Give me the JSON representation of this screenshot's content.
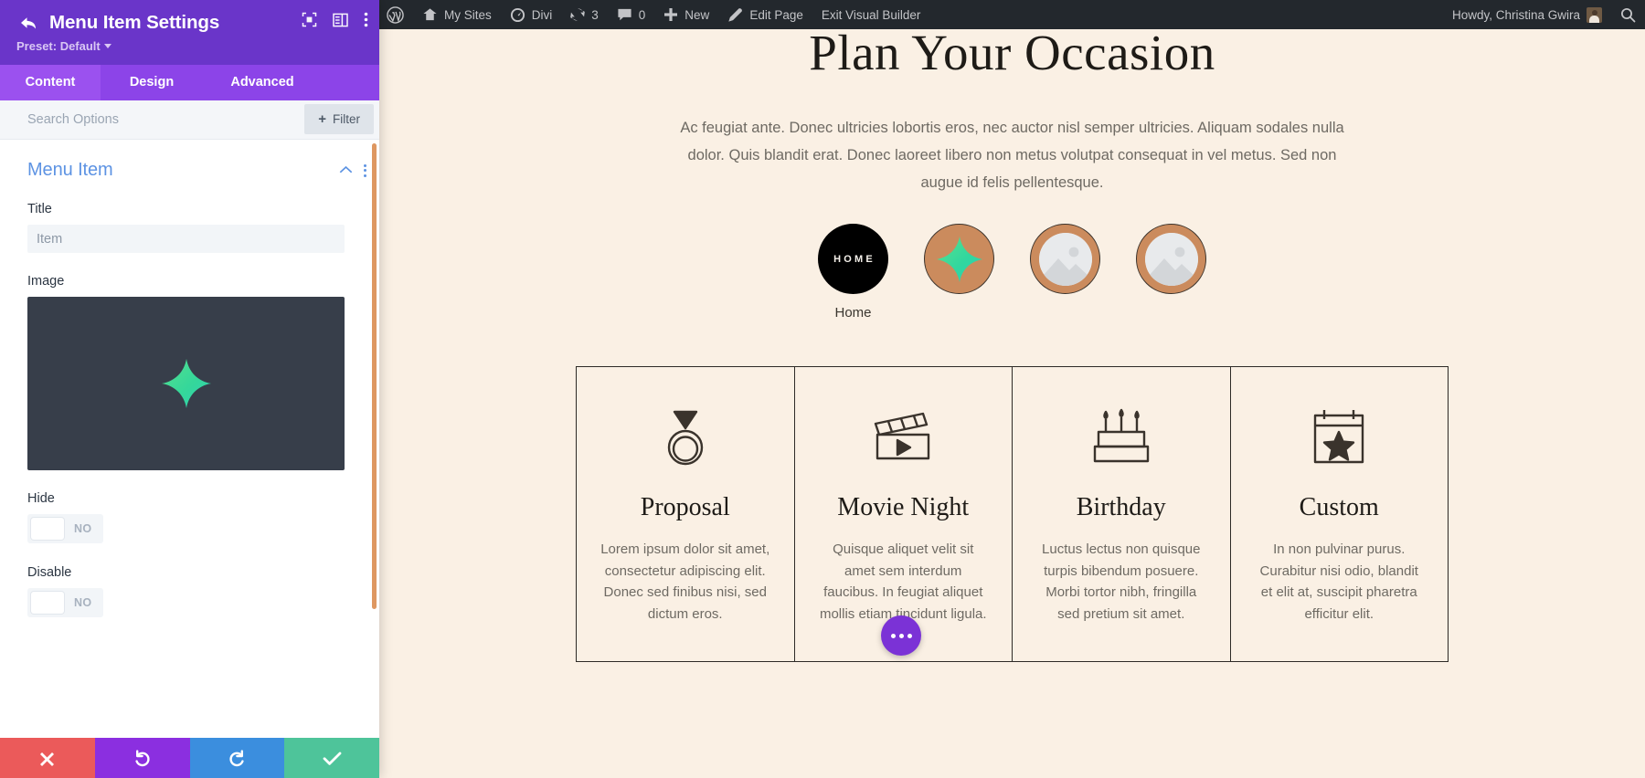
{
  "panel": {
    "title": "Menu Item Settings",
    "preset_label": "Preset: Default",
    "back_icon": "back-arrow-icon",
    "header_icon_1": "focus-target-icon",
    "header_icon_2": "layout-columns-icon",
    "header_icon_3": "more-vertical-icon",
    "tabs": [
      {
        "label": "Content",
        "active": true
      },
      {
        "label": "Design",
        "active": false
      },
      {
        "label": "Advanced",
        "active": false
      }
    ],
    "search_placeholder": "Search Options",
    "search_value": "",
    "filter_label": "Filter",
    "section": {
      "title": "Menu Item",
      "collapse_icon": "chevron-up-icon",
      "menu_icon": "more-vertical-icon"
    },
    "fields": {
      "title_label": "Title",
      "title_placeholder": "Item",
      "title_value": "",
      "image_label": "Image",
      "hide_label": "Hide",
      "hide_value": "NO",
      "disable_label": "Disable",
      "disable_value": "NO"
    },
    "footer": [
      {
        "name": "cancel-button",
        "icon": "close-icon",
        "color": "#eb5a5a"
      },
      {
        "name": "undo-button",
        "icon": "undo-icon",
        "color": "#8b2fe0"
      },
      {
        "name": "redo-button",
        "icon": "redo-icon",
        "color": "#3b8ede"
      },
      {
        "name": "save-button",
        "icon": "check-icon",
        "color": "#4ec49a"
      }
    ],
    "colors": {
      "header_purple": "#6a35c9",
      "tab_purple": "#8c44e8",
      "active_tab_purple": "#9b51ef",
      "section_blue": "#5d93e3"
    }
  },
  "adminbar": {
    "items": [
      {
        "label": "",
        "icon": "wordpress-logo-icon"
      },
      {
        "label": "My Sites",
        "icon": "sites-icon"
      },
      {
        "label": "Divi",
        "icon": "dashboard-icon"
      },
      {
        "label": "3",
        "icon": "updates-icon"
      },
      {
        "label": "0",
        "icon": "comments-icon"
      },
      {
        "label": "New",
        "icon": "plus-icon"
      },
      {
        "label": "Edit Page",
        "icon": "pencil-icon"
      },
      {
        "label": "Exit Visual Builder",
        "icon": ""
      }
    ],
    "howdy": "Howdy, Christina Gwira",
    "avatar": "user-avatar",
    "search_icon": "search-icon"
  },
  "page": {
    "heading": "Plan Your Occasion",
    "subtext": "Ac feugiat ante. Donec ultricies lobortis eros, nec auctor nisl semper ultricies. Aliquam sodales nulla dolor. Quis blandit erat. Donec laoreet libero non metus volutpat consequat in vel metus. Sed non augue id felis pellentesque.",
    "menu_circles": [
      {
        "type": "home",
        "text": "HOME",
        "label": "Home"
      },
      {
        "type": "sparkle",
        "text": "",
        "label": ""
      },
      {
        "type": "placeholder",
        "text": "",
        "label": ""
      },
      {
        "type": "placeholder",
        "text": "",
        "label": ""
      }
    ],
    "cards": [
      {
        "icon": "ring-icon",
        "title": "Proposal",
        "text": "Lorem ipsum dolor sit amet, consectetur adipiscing elit. Donec sed finibus nisi, sed dictum eros."
      },
      {
        "icon": "clapperboard-icon",
        "title": "Movie Night",
        "text": "Quisque aliquet velit sit amet sem interdum faucibus. In feugiat aliquet mollis etiam tincidunt ligula."
      },
      {
        "icon": "birthday-cake-icon",
        "title": "Birthday",
        "text": "Luctus lectus non quisque turpis bibendum posuere. Morbi tortor nibh, fringilla sed pretium sit amet."
      },
      {
        "icon": "calendar-star-icon",
        "title": "Custom",
        "text": "In non pulvinar purus. Curabitur nisi odio, blandit et elit at, suscipit pharetra efficitur elit."
      }
    ],
    "fab_icon": "more-horizontal-icon",
    "colors": {
      "background": "#faf0e4",
      "tan_circle": "#cb8b5d",
      "ink": "#1e1b17",
      "fab_purple": "#7b32d6",
      "sparkle_green": "#3fd98a"
    }
  }
}
